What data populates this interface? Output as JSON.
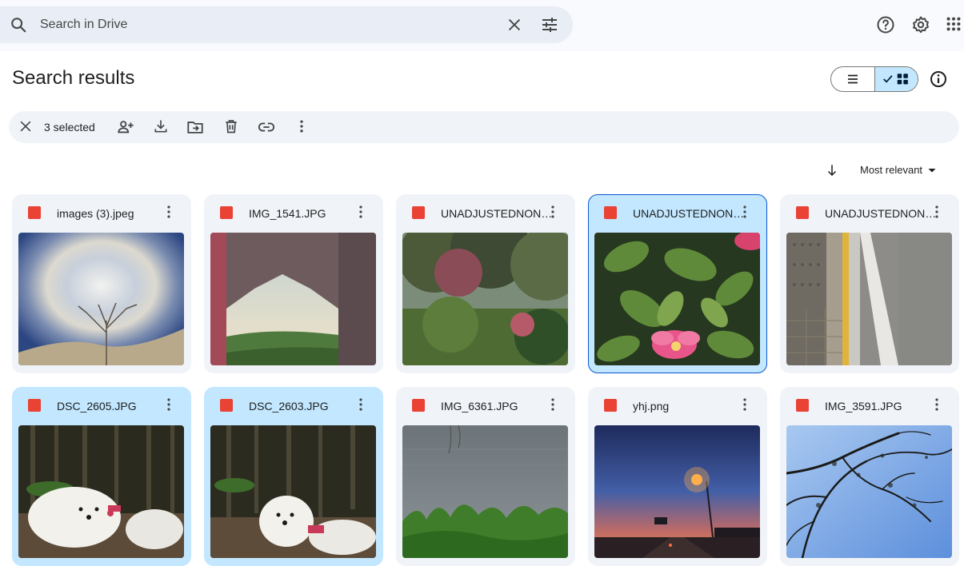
{
  "search": {
    "placeholder": "Search in Drive",
    "value": ""
  },
  "page": {
    "title": "Search results"
  },
  "selection": {
    "count_label": "3 selected"
  },
  "sort": {
    "label": "Most relevant"
  },
  "colors": {
    "accent": "#0b57d0",
    "selected_bg": "#c2e7ff",
    "card_bg": "#f0f4f9",
    "image_icon": "#ea4335"
  },
  "files": [
    {
      "name": "images (3).jpeg",
      "selected": false
    },
    {
      "name": "IMG_1541.JPG",
      "selected": false
    },
    {
      "name": "UNADJUSTEDNONRAW_thumb.jpg",
      "selected": false
    },
    {
      "name": "UNADJUSTEDNONRAW_thumb.jpg",
      "selected": false,
      "focused": true
    },
    {
      "name": "UNADJUSTEDNONRAW_thumb.jpg",
      "selected": false
    },
    {
      "name": "DSC_2605.JPG",
      "selected": true
    },
    {
      "name": "DSC_2603.JPG",
      "selected": true
    },
    {
      "name": "IMG_6361.JPG",
      "selected": false
    },
    {
      "name": "yhj.png",
      "selected": false
    },
    {
      "name": "IMG_3591.JPG",
      "selected": false
    }
  ]
}
